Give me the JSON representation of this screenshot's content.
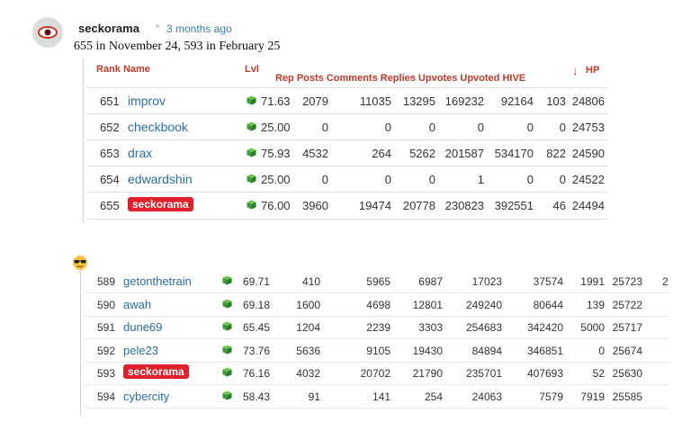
{
  "post": {
    "author": "seckorama",
    "time": "3 months ago",
    "summary": "655 in November 24, 593 in February 25"
  },
  "table1": {
    "headers": {
      "rank_name": "Rank Name",
      "lvl": "Lvl",
      "rep_posts": "Rep Posts Comments Replies Upvotes Upvoted HIVE",
      "hp": "HP",
      "sort_arrow": "↓"
    },
    "rows": [
      {
        "rank": "651",
        "name": "improv",
        "rep": "71.63",
        "posts": "2079",
        "comments": "11035",
        "replies": "13295",
        "upvotes": "169232",
        "upvoted": "92164",
        "hive": "103",
        "hp": "24806",
        "highlight": false
      },
      {
        "rank": "652",
        "name": "checkbook",
        "rep": "25.00",
        "posts": "0",
        "comments": "0",
        "replies": "0",
        "upvotes": "0",
        "upvoted": "0",
        "hive": "0",
        "hp": "24753",
        "highlight": false
      },
      {
        "rank": "653",
        "name": "drax",
        "rep": "75.93",
        "posts": "4532",
        "comments": "264",
        "replies": "5262",
        "upvotes": "201587",
        "upvoted": "534170",
        "hive": "822",
        "hp": "24590",
        "highlight": false
      },
      {
        "rank": "654",
        "name": "edwardshin",
        "rep": "25.00",
        "posts": "0",
        "comments": "0",
        "replies": "0",
        "upvotes": "1",
        "upvoted": "0",
        "hive": "0",
        "hp": "24522",
        "highlight": false
      },
      {
        "rank": "655",
        "name": "seckorama",
        "rep": "76.00",
        "posts": "3960",
        "comments": "19474",
        "replies": "20778",
        "upvotes": "230823",
        "upvoted": "392551",
        "hive": "46",
        "hp": "24494",
        "highlight": true
      }
    ]
  },
  "emoji": "sunglasses-emoji",
  "table2": {
    "rows": [
      {
        "rank": "589",
        "name": "getonthetrain",
        "rep": "69.71",
        "posts": "410",
        "comments": "5965",
        "replies": "6987",
        "upvotes": "17023",
        "upvoted": "37574",
        "hive": "1991",
        "hp": "25723",
        "highlight": false
      },
      {
        "rank": "590",
        "name": "awah",
        "rep": "69.18",
        "posts": "1600",
        "comments": "4698",
        "replies": "12801",
        "upvotes": "249240",
        "upvoted": "80644",
        "hive": "139",
        "hp": "25722",
        "highlight": false
      },
      {
        "rank": "591",
        "name": "dune69",
        "rep": "65.45",
        "posts": "1204",
        "comments": "2239",
        "replies": "3303",
        "upvotes": "254683",
        "upvoted": "342420",
        "hive": "5000",
        "hp": "25717",
        "highlight": false
      },
      {
        "rank": "592",
        "name": "pele23",
        "rep": "73.76",
        "posts": "5636",
        "comments": "9105",
        "replies": "19430",
        "upvotes": "84894",
        "upvoted": "346851",
        "hive": "0",
        "hp": "25674",
        "highlight": false
      },
      {
        "rank": "593",
        "name": "seckorama",
        "rep": "76.16",
        "posts": "4032",
        "comments": "20702",
        "replies": "21790",
        "upvotes": "235701",
        "upvoted": "407693",
        "hive": "52",
        "hp": "25630",
        "highlight": true
      },
      {
        "rank": "594",
        "name": "cybercity",
        "rep": "58.43",
        "posts": "91",
        "comments": "141",
        "replies": "254",
        "upvotes": "24063",
        "upvoted": "7579",
        "hive": "7919",
        "hp": "25585",
        "highlight": false
      }
    ],
    "stray_text": "2"
  },
  "colors": {
    "accent": "#c0392b",
    "link": "#2b6ea3",
    "highlight": "#e0202a",
    "cube": "#3d9a3a"
  }
}
